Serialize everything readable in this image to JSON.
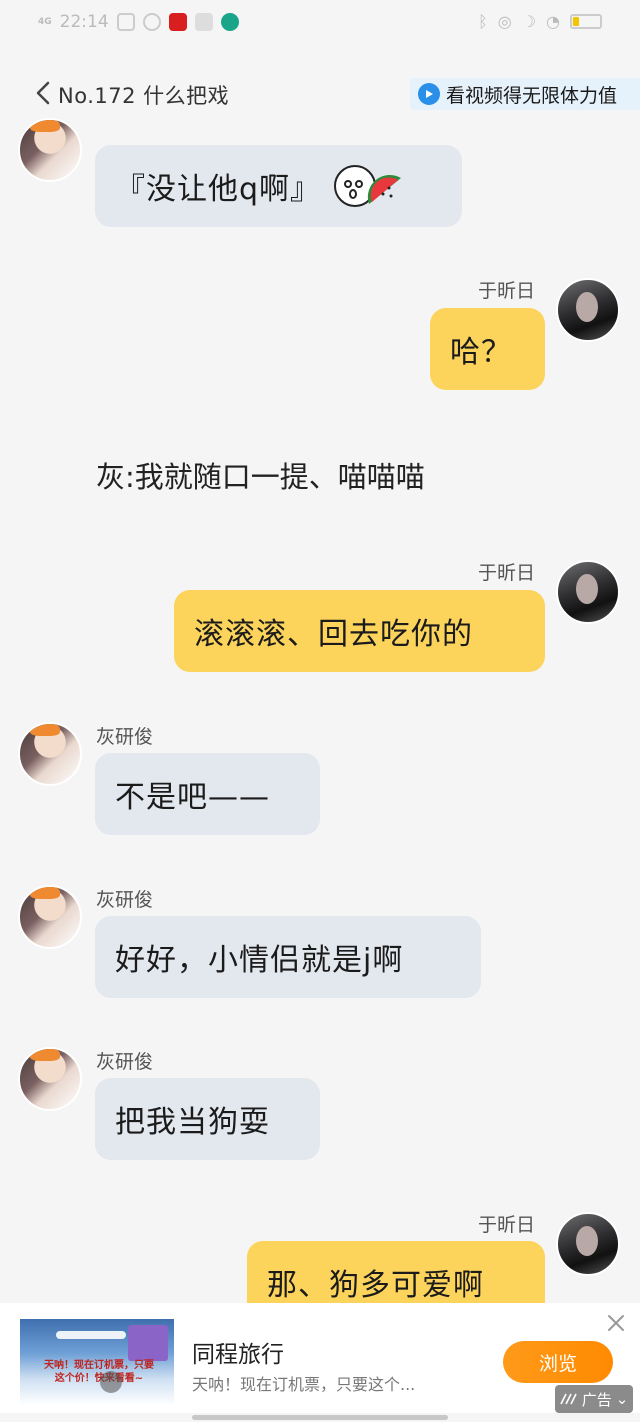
{
  "status_bar": {
    "network": "4G",
    "time": "22:14"
  },
  "nav": {
    "title": "No.172 什么把戏",
    "promo": "看视频得无限体力值"
  },
  "messages": [
    {
      "side": "left",
      "text": "『没让他q啊』"
    },
    {
      "side": "right",
      "sender": "于昕日",
      "text": "哈？"
    },
    {
      "side": "right",
      "sender": "于昕日",
      "text": "滚滚滚、回去吃你的"
    },
    {
      "side": "left",
      "sender": "灰研俊",
      "text": "不是吧——"
    },
    {
      "side": "left",
      "sender": "灰研俊",
      "text": "好好，小情侣就是j啊"
    },
    {
      "side": "left",
      "sender": "灰研俊",
      "text": "把我当狗耍"
    },
    {
      "side": "right",
      "sender": "于昕日",
      "text": "那、狗多可爱啊"
    }
  ],
  "narration": "灰:我就随口一提、喵喵喵",
  "ad": {
    "thumb_text": "天呐！现在订机票，只要这个价！快来看看~",
    "name": "同程旅行",
    "description": "天呐！现在订机票，只要这个...",
    "button": "浏览",
    "tag": "广告"
  },
  "colors": {
    "left_bubble": "#e3e7ee",
    "right_bubble": "#fcd45c",
    "ad_button": "#ff8a00",
    "promo_bg": "#e6f2fb"
  },
  "icons": {
    "back": "chevron-left-icon",
    "promo": "play-circle-icon",
    "sticker": "face-watermelon-icon",
    "ad_close": "close-icon"
  }
}
